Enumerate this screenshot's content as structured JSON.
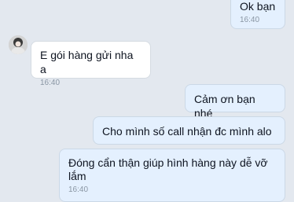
{
  "messages": [
    {
      "text": "Ok bạn",
      "time": "16:40",
      "sender": "me"
    },
    {
      "text": "E gói hàng gửi nha a",
      "time": "16:40",
      "sender": "contact"
    },
    {
      "text": "Cảm ơn bạn nhé",
      "time": "",
      "sender": "me"
    },
    {
      "text": "Cho mình số call nhận đc mình alo",
      "time": "",
      "sender": "me"
    },
    {
      "text": "Đóng cẩn thận giúp hình hàng này dễ vỡ lắm",
      "time": "16:40",
      "sender": "me"
    }
  ],
  "colors": {
    "background": "#e3e8ef",
    "sent_bubble": "#e4f0fe",
    "received_bubble": "#ffffff",
    "timestamp": "#8a96a4"
  },
  "icons": {
    "avatar": "contact-avatar"
  }
}
